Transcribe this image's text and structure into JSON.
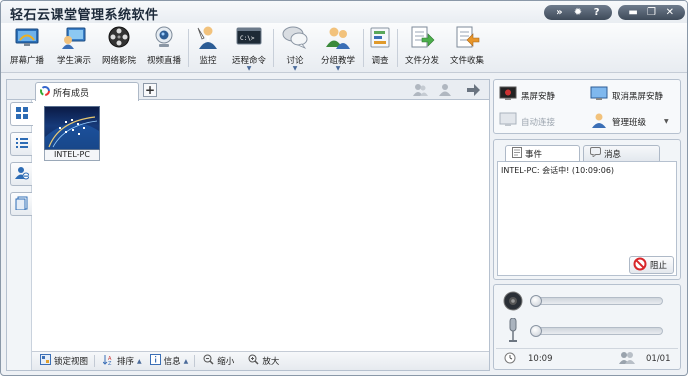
{
  "app": {
    "title": "轻石云课堂管理系统软件"
  },
  "window_controls": {
    "collapse_icon": "double-chevron-down-icon",
    "settings_icon": "gear-icon",
    "help_label": "?",
    "minimize_icon": "minimize-icon",
    "restore_icon": "restore-icon",
    "close_label": "✕"
  },
  "toolbar": {
    "items": [
      {
        "id": "screen-broadcast",
        "label": "屏幕广播",
        "icon": "monitor-broadcast-icon"
      },
      {
        "id": "student-demo",
        "label": "学生演示",
        "icon": "student-demo-icon"
      },
      {
        "id": "network-video",
        "label": "网络影院",
        "icon": "film-reel-icon"
      },
      {
        "id": "video-live",
        "label": "视频直播",
        "icon": "webcam-icon"
      },
      {
        "id": "monitor",
        "label": "监控",
        "icon": "monitor-person-icon"
      },
      {
        "id": "remote-command",
        "label": "远程命令",
        "icon": "terminal-icon"
      },
      {
        "id": "discussion",
        "label": "讨论",
        "icon": "chat-bubbles-icon"
      },
      {
        "id": "group-teaching",
        "label": "分组教学",
        "icon": "group-users-icon"
      },
      {
        "id": "survey",
        "label": "调查",
        "icon": "survey-chart-icon"
      },
      {
        "id": "file-distribute",
        "label": "文件分发",
        "icon": "file-send-icon"
      },
      {
        "id": "file-collect",
        "label": "文件收集",
        "icon": "file-receive-icon"
      }
    ]
  },
  "members": {
    "tab_label": "所有成员",
    "add_tab_label": "+",
    "students": [
      {
        "name": "INTEL-PC",
        "status": "online"
      }
    ]
  },
  "bottombar": {
    "lock_view": "锁定视图",
    "sort": "排序",
    "info": "信息",
    "zoom_out": "缩小",
    "zoom_in": "放大"
  },
  "right_panel": {
    "black_screen": "黑屏安静",
    "cancel_black_screen": "取消黑屏安静",
    "auto_connect": "自动连接",
    "manage_class": "管理班级"
  },
  "events": {
    "tab_events": "事件",
    "tab_messages": "消息",
    "lines": [
      "INTEL-PC: 会话中! (10:09:06)"
    ],
    "stop_label": "阻止"
  },
  "audio": {
    "speaker_volume": 0.0,
    "mic_volume": 0.0,
    "clock": "10:09",
    "online_count": "01/01"
  },
  "colors": {
    "accent": "#3b6fb6",
    "toolbar_bg": "#eef1f5",
    "stop_red": "#d8262a"
  }
}
